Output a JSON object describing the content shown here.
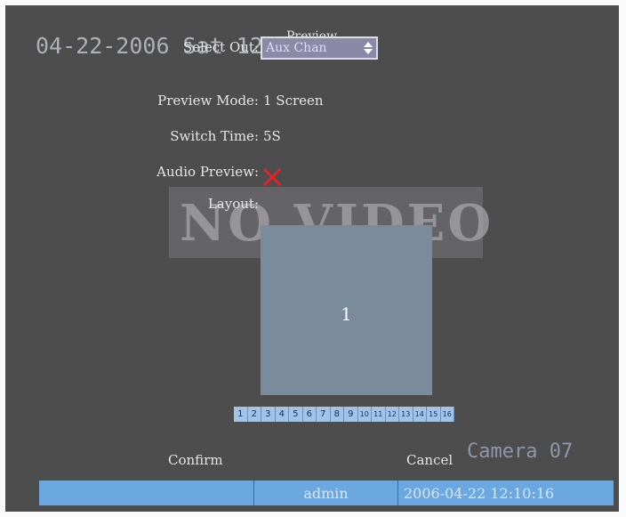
{
  "osd": {
    "datetime": "04-22-2006 Sat 12:10:16",
    "camera_label": "Camera 07"
  },
  "menu": {
    "title": "Preview",
    "select_out_label": "Select Out:",
    "select_out_value": "Aux Chan",
    "preview_mode_label": "Preview Mode:",
    "preview_mode_value": "1 Screen",
    "switch_time_label": "Switch Time:",
    "switch_time_value": "5S",
    "audio_preview_label": "Audio Preview:",
    "audio_preview_icon": "red-x-icon",
    "layout_label": "Layout:",
    "layout_cell": "1",
    "channels": [
      "1",
      "2",
      "3",
      "4",
      "5",
      "6",
      "7",
      "8",
      "9",
      "10",
      "11",
      "12",
      "13",
      "14",
      "15",
      "16"
    ]
  },
  "overlay": {
    "no_video": "NO VIDEO"
  },
  "buttons": {
    "confirm": "Confirm",
    "cancel": "Cancel"
  },
  "status_bar": {
    "user": "admin",
    "datetime": "2006-04-22 12:10:16"
  },
  "colors": {
    "background": "#4d4d4e",
    "status_bar": "#6ca8e0",
    "layout_cell": "#7a8b9c",
    "audio_off": "#e0252a"
  }
}
